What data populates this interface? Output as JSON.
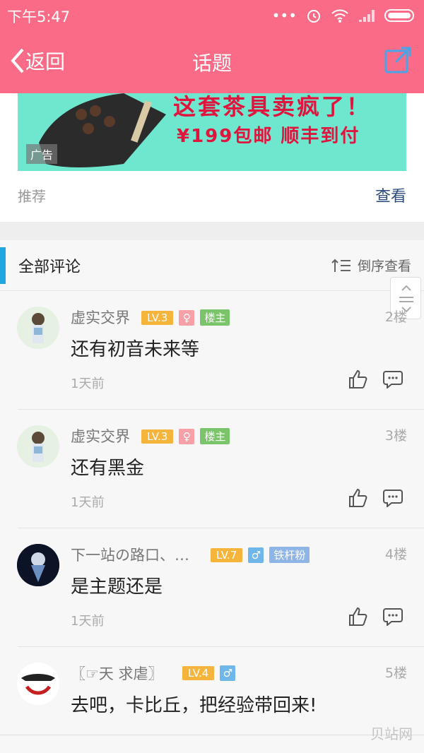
{
  "status": {
    "time": "下午5:47"
  },
  "header": {
    "back": "返回",
    "title": "话题"
  },
  "ad": {
    "line1": "这套茶具卖疯了！",
    "line2": "¥199包邮    顺丰到付",
    "tag": "广告"
  },
  "recommend": {
    "label": "推荐",
    "action": "查看"
  },
  "section": {
    "title": "全部评论",
    "sort": "倒序查看"
  },
  "comments": [
    {
      "name": "虚实交界",
      "level": "LV.3",
      "gender": "♀",
      "role": "楼主",
      "floor": "2楼",
      "text": "还有初音未来等",
      "ago": "1天前"
    },
    {
      "name": "虚实交界",
      "level": "LV.3",
      "gender": "♀",
      "role": "楼主",
      "floor": "3楼",
      "text": "还有黑金",
      "ago": "1天前"
    },
    {
      "name": "下一站の路口、…",
      "level": "LV.7",
      "gender": "♂",
      "role": "铁杆粉",
      "floor": "4楼",
      "text": "是主题还是",
      "ago": "1天前"
    },
    {
      "name": "〖☞天 求虐〗",
      "level": "LV.4",
      "gender": "♂",
      "role": "",
      "floor": "5楼",
      "text": "去吧，卡比丘，把经验带回来!",
      "ago": ""
    }
  ],
  "watermark": "贝站网",
  "colors": {
    "header": "#f96b86",
    "accent": "#1ea7e1",
    "ad_bg": "#6fe7cf"
  }
}
